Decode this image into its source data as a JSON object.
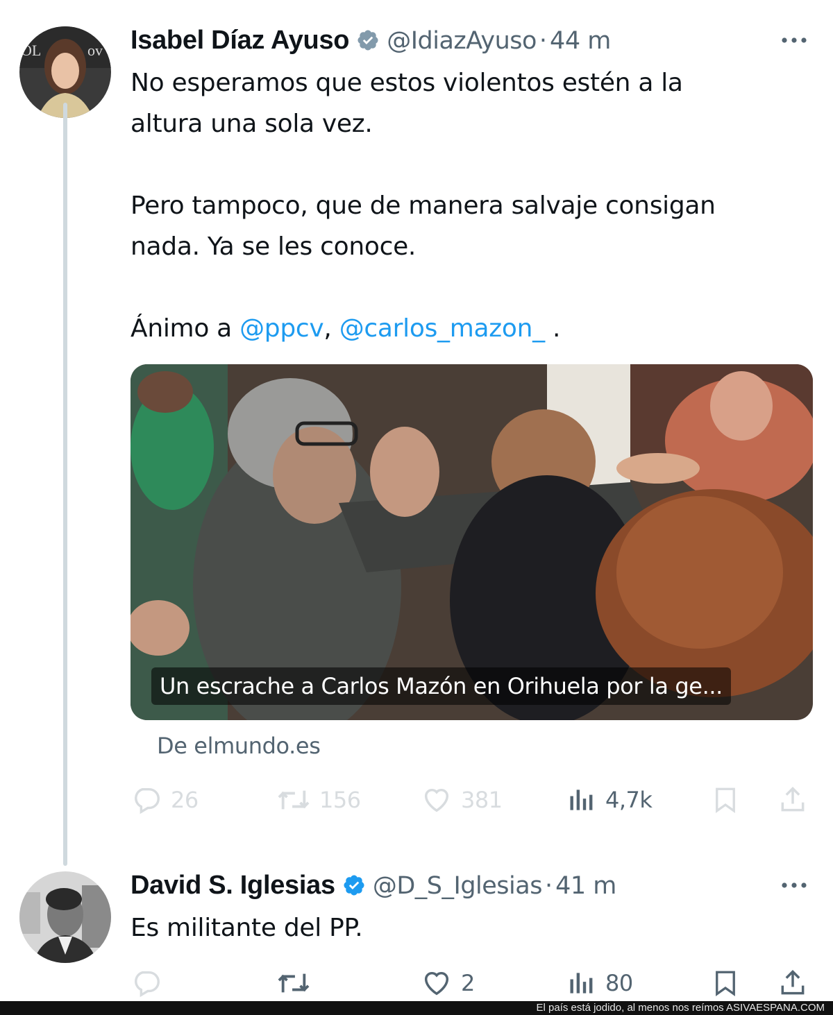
{
  "tweet1": {
    "name": "Isabel Díaz Ayuso",
    "handle": "@IdiazAyuso",
    "separator": "·",
    "time": "44 m",
    "text_lines": [
      "No esperamos que estos violentos estén a la",
      "altura una sola vez.",
      "Pero tampoco, que de manera salvaje consigan",
      "nada. Ya se les conoce."
    ],
    "closing_prefix": "Ánimo a ",
    "mention1": "@ppcv",
    "mention_sep": ", ",
    "mention2": "@carlos_mazon_",
    "closing_suffix": " .",
    "media_caption": "Un escrache a Carlos Mazón en Orihuela por la ge...",
    "source": "De elmundo.es",
    "replies": "26",
    "retweets": "156",
    "likes": "381",
    "views": "4,7k"
  },
  "tweet2": {
    "name": "David S. Iglesias",
    "handle": "@D_S_Iglesias",
    "separator": "·",
    "time": "41 m",
    "text": "Es militante del PP.",
    "likes": "2",
    "views": "80"
  },
  "footer": {
    "text": "El país está jodido, al menos nos reímos ASIVAESPANA.COM"
  },
  "colors": {
    "text": "#0f1419",
    "secondary": "#536471",
    "link": "#1d9bf0",
    "verified": "#829aab"
  },
  "icons": [
    "verified-badge-icon",
    "more-icon",
    "reply-icon",
    "retweet-icon",
    "like-icon",
    "views-icon",
    "bookmark-icon",
    "share-icon"
  ]
}
